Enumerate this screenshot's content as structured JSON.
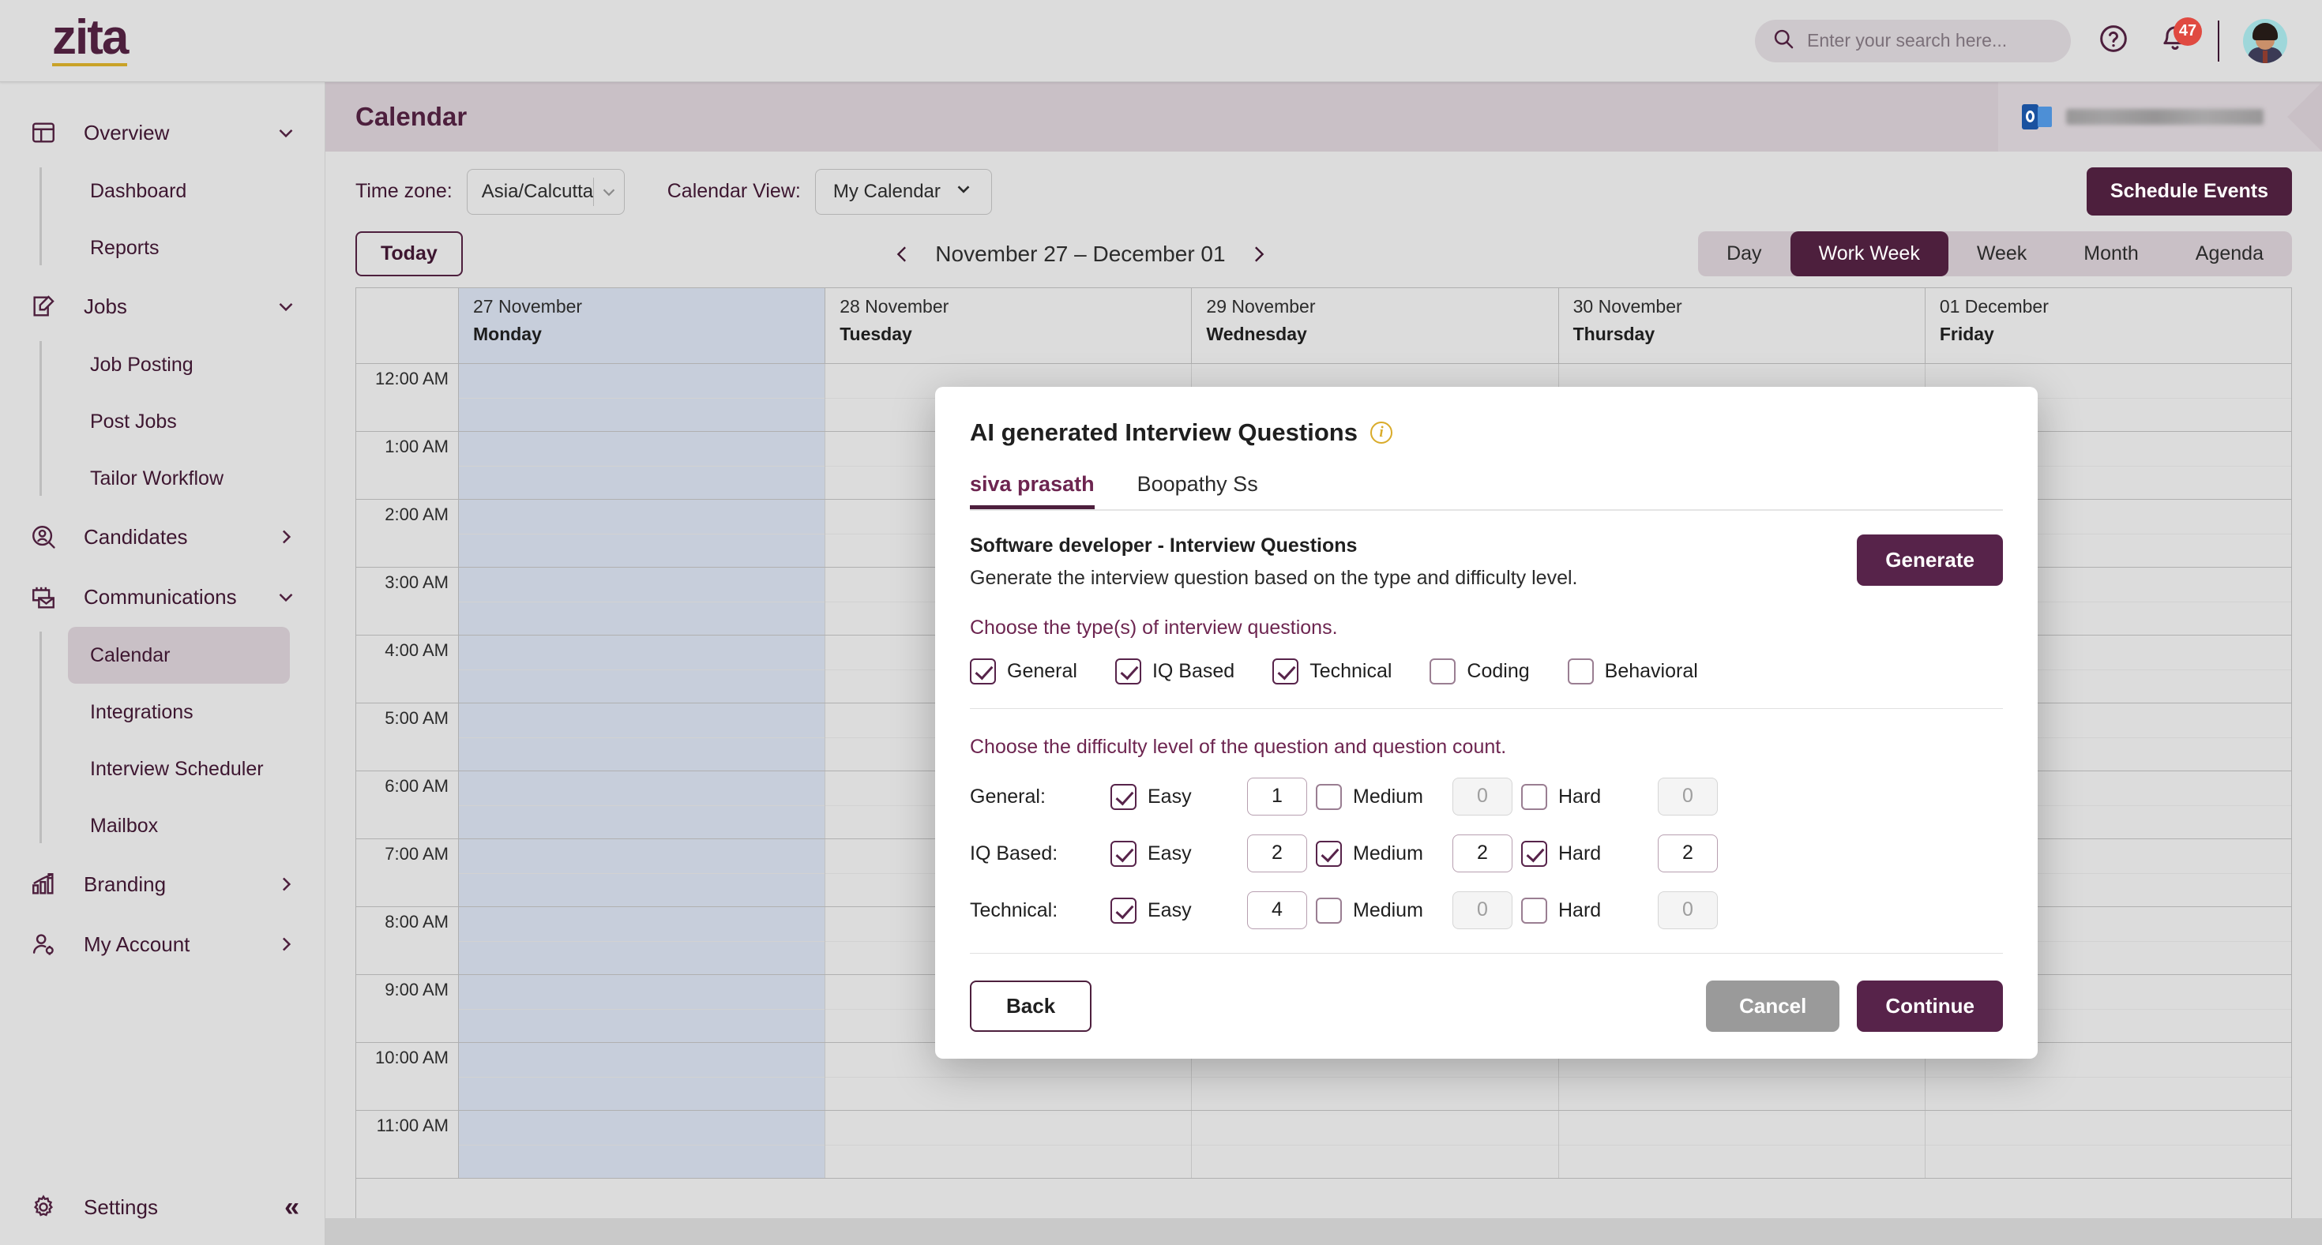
{
  "brand": {
    "name": "zita",
    "accent": "#4d1f3d",
    "gold": "#c9a227"
  },
  "topbar": {
    "search_placeholder": "Enter your search here...",
    "notification_count": "47"
  },
  "sidebar": {
    "groups": [
      {
        "label": "Overview",
        "icon": "layout-icon",
        "state": "expanded",
        "items": [
          {
            "label": "Dashboard"
          },
          {
            "label": "Reports"
          }
        ]
      },
      {
        "label": "Jobs",
        "icon": "edit-square-icon",
        "state": "expanded",
        "items": [
          {
            "label": "Job Posting"
          },
          {
            "label": "Post Jobs"
          },
          {
            "label": "Tailor Workflow"
          }
        ]
      },
      {
        "label": "Candidates",
        "icon": "user-search-icon",
        "state": "collapsed",
        "items": []
      },
      {
        "label": "Communications",
        "icon": "calendar-mail-icon",
        "state": "expanded",
        "items": [
          {
            "label": "Calendar",
            "active": true
          },
          {
            "label": "Integrations"
          },
          {
            "label": "Interview Scheduler"
          },
          {
            "label": "Mailbox"
          }
        ]
      },
      {
        "label": "Branding",
        "icon": "bar-chart-icon",
        "state": "collapsed",
        "items": []
      },
      {
        "label": "My Account",
        "icon": "user-gear-icon",
        "state": "collapsed",
        "items": []
      }
    ],
    "settings_label": "Settings"
  },
  "page": {
    "title": "Calendar",
    "connected_account": "redacted-email-address",
    "timezone_label": "Time zone:",
    "timezone_value": "Asia/Calcutta",
    "calendar_view_label": "Calendar View:",
    "calendar_view_value": "My Calendar",
    "schedule_events_label": "Schedule Events",
    "today_label": "Today",
    "date_range": "November 27 – December 01",
    "views": [
      {
        "label": "Day",
        "active": false
      },
      {
        "label": "Work Week",
        "active": true
      },
      {
        "label": "Week",
        "active": false
      },
      {
        "label": "Month",
        "active": false
      },
      {
        "label": "Agenda",
        "active": false
      }
    ]
  },
  "calendar": {
    "days": [
      {
        "date": "27 November",
        "name": "Monday",
        "highlight": true
      },
      {
        "date": "28 November",
        "name": "Tuesday",
        "highlight": false
      },
      {
        "date": "29 November",
        "name": "Wednesday",
        "highlight": false
      },
      {
        "date": "30 November",
        "name": "Thursday",
        "highlight": false
      },
      {
        "date": "01 December",
        "name": "Friday",
        "highlight": false
      }
    ],
    "hours": [
      "12:00 AM",
      "1:00 AM",
      "2:00 AM",
      "3:00 AM",
      "4:00 AM",
      "5:00 AM",
      "6:00 AM",
      "7:00 AM",
      "8:00 AM",
      "9:00 AM",
      "10:00 AM",
      "11:00 AM"
    ]
  },
  "modal": {
    "title": "AI generated Interview Questions",
    "tabs": [
      {
        "label": "siva prasath",
        "active": true
      },
      {
        "label": "Boopathy Ss",
        "active": false
      }
    ],
    "heading": "Software developer - Interview Questions",
    "description": "Generate the interview question based on the type and difficulty level.",
    "generate_label": "Generate",
    "type_section_label": "Choose the type(s) of interview questions.",
    "types": [
      {
        "label": "General",
        "checked": true
      },
      {
        "label": "IQ Based",
        "checked": true
      },
      {
        "label": "Technical",
        "checked": true
      },
      {
        "label": "Coding",
        "checked": false
      },
      {
        "label": "Behavioral",
        "checked": false
      }
    ],
    "difficulty_section_label": "Choose the difficulty level of the question and question count.",
    "difficulty_rows": [
      {
        "name": "General:",
        "levels": [
          {
            "label": "Easy",
            "checked": true,
            "count": "1"
          },
          {
            "label": "Medium",
            "checked": false,
            "count": "0"
          },
          {
            "label": "Hard",
            "checked": false,
            "count": "0"
          }
        ]
      },
      {
        "name": "IQ Based:",
        "levels": [
          {
            "label": "Easy",
            "checked": true,
            "count": "2"
          },
          {
            "label": "Medium",
            "checked": true,
            "count": "2"
          },
          {
            "label": "Hard",
            "checked": true,
            "count": "2"
          }
        ]
      },
      {
        "name": "Technical:",
        "levels": [
          {
            "label": "Easy",
            "checked": true,
            "count": "4"
          },
          {
            "label": "Medium",
            "checked": false,
            "count": "0"
          },
          {
            "label": "Hard",
            "checked": false,
            "count": "0"
          }
        ]
      }
    ],
    "back_label": "Back",
    "cancel_label": "Cancel",
    "continue_label": "Continue"
  }
}
